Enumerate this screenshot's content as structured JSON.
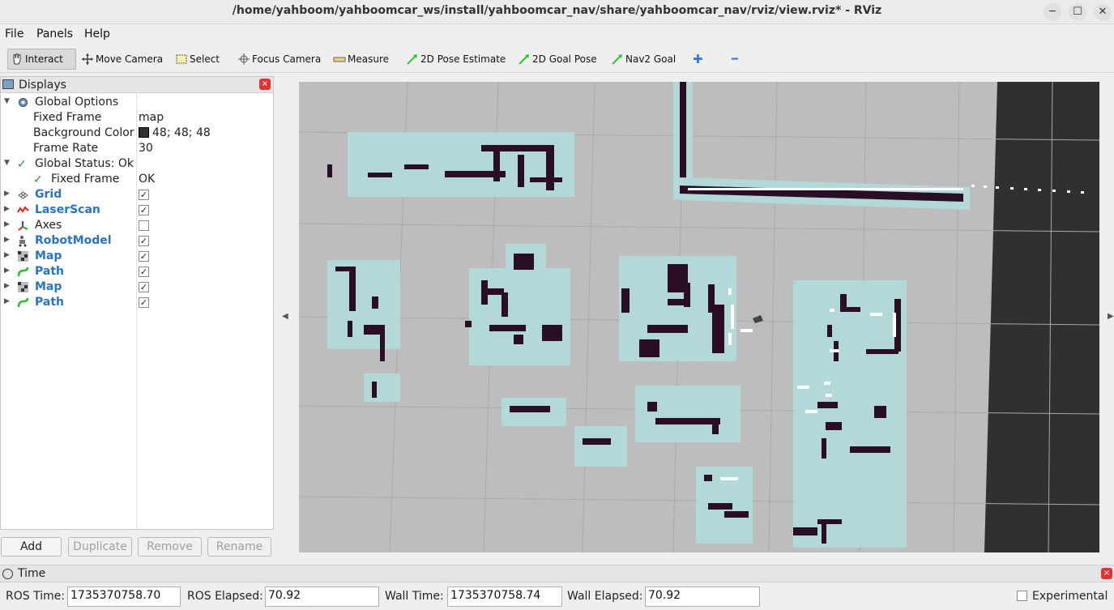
{
  "window": {
    "title": "/home/yahboom/yahboomcar_ws/install/yahboomcar_nav/share/yahboomcar_nav/rviz/view.rviz* - RViz",
    "minimize": "─",
    "maximize": "☐",
    "close": "✕"
  },
  "menubar": {
    "file": "File",
    "panels": "Panels",
    "help": "Help"
  },
  "toolbar": {
    "interact": "Interact",
    "move_camera": "Move Camera",
    "select": "Select",
    "focus_camera": "Focus Camera",
    "measure": "Measure",
    "pose_estimate": "2D Pose Estimate",
    "goal_pose": "2D Goal Pose",
    "nav2_goal": "Nav2 Goal",
    "plus": "✚",
    "minus": "━"
  },
  "displays": {
    "title": "Displays",
    "close_glyph": "×",
    "rows": [
      {
        "label": "Global Options",
        "value": ""
      },
      {
        "label": "Fixed Frame",
        "value": "map"
      },
      {
        "label": "Background Color",
        "value": "48; 48; 48"
      },
      {
        "label": "Frame Rate",
        "value": "30"
      },
      {
        "label": "Global Status: Ok",
        "value": ""
      },
      {
        "label": "Fixed Frame",
        "value": "OK"
      },
      {
        "label": "Grid",
        "checked": "✓"
      },
      {
        "label": "LaserScan",
        "checked": "✓"
      },
      {
        "label": "Axes",
        "checked": ""
      },
      {
        "label": "RobotModel",
        "checked": "✓"
      },
      {
        "label": "Map",
        "checked": "✓"
      },
      {
        "label": "Path",
        "checked": "✓"
      },
      {
        "label": "Map",
        "checked": "✓"
      },
      {
        "label": "Path",
        "checked": "✓"
      }
    ],
    "background_color": "#303030",
    "buttons": {
      "add": "Add",
      "duplicate": "Duplicate",
      "remove": "Remove",
      "rename": "Rename"
    }
  },
  "viewport": {
    "background": "#303030",
    "map_free_color": "#bdbdbd",
    "inflation_color": "#b2d8d8",
    "obstacle_color": "#2a0f24"
  },
  "time": {
    "title": "Time",
    "close_glyph": "×",
    "ros_time_label": "ROS Time:",
    "ros_time": "1735370758.70",
    "ros_elapsed_label": "ROS Elapsed:",
    "ros_elapsed": "70.92",
    "wall_time_label": "Wall Time:",
    "wall_time": "1735370758.74",
    "wall_elapsed_label": "Wall Elapsed:",
    "wall_elapsed": "70.92",
    "experimental_label": "Experimental"
  }
}
